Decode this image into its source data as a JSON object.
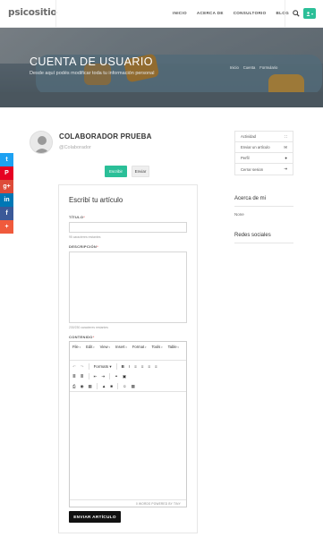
{
  "header": {
    "logo": "psicositio",
    "nav": [
      "INICIO",
      "ACERCA DE",
      "CONSULTORIO",
      "BLOG"
    ],
    "search_icon": "search-icon",
    "user_menu_icon": "user-icon",
    "user_menu_caret": "▾"
  },
  "hero": {
    "title": "CUENTA DE USUARIO",
    "subtitle": "Desde aquí podés modificar toda tu información personal",
    "breadcrumbs": [
      "Inicio",
      "Cuenta",
      "Formulario"
    ]
  },
  "social": [
    {
      "icon": "twitter-icon",
      "glyph": "t",
      "color": "#1da1f2"
    },
    {
      "icon": "pinterest-icon",
      "glyph": "P",
      "color": "#e60023"
    },
    {
      "icon": "google-plus-icon",
      "glyph": "g+",
      "color": "#dd4b39"
    },
    {
      "icon": "linkedin-icon",
      "glyph": "in",
      "color": "#0077b5"
    },
    {
      "icon": "facebook-icon",
      "glyph": "f",
      "color": "#3b5998"
    },
    {
      "icon": "more-share-icon",
      "glyph": "+",
      "color": "#f05a3c"
    }
  ],
  "profile": {
    "name": "COLABORADOR PRUEBA",
    "role": "@Colaborador",
    "write_button": "Escribir",
    "send_button": "Enviar"
  },
  "side_menu": [
    {
      "label": "Actividad",
      "icon": "rss-icon",
      "glyph": "∷"
    },
    {
      "label": "Enviar un artículo",
      "icon": "envelope-icon",
      "glyph": "✉"
    },
    {
      "label": "Perfil",
      "icon": "user-icon",
      "glyph": "●"
    },
    {
      "label": "Cerrar sesion",
      "icon": "logout-icon",
      "glyph": "⇥"
    }
  ],
  "about": {
    "title": "Acerca de mi",
    "value": "None"
  },
  "social_networks": {
    "title": "Redes sociales"
  },
  "form": {
    "title": "Escribí tu artículo",
    "title_label": "TÍTULO",
    "title_hint": "95 caracteres restantes",
    "description_label": "DESCRIPCIÓN",
    "description_hint": "230/230 caracteres restantes",
    "content_label": "CONTENIDO",
    "required_mark": "*",
    "submit": "ENVIAR ARTÍCULO"
  },
  "editor": {
    "menus": [
      "File",
      "Edit",
      "View",
      "Insert",
      "Format",
      "Tools",
      "Table"
    ],
    "formats_label": "Formats",
    "status": "0 WORDS POWERED BY TINY"
  },
  "colors": {
    "accent": "#2bbf98",
    "submit": "#111111"
  }
}
